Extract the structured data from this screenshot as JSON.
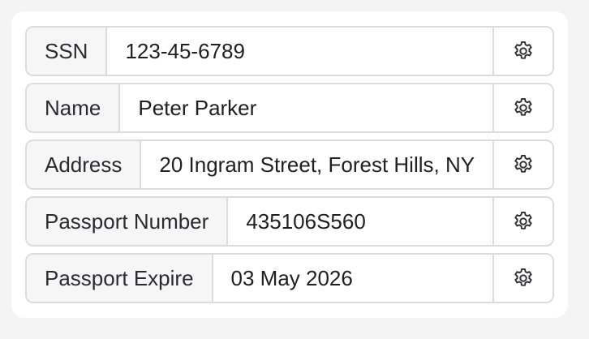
{
  "fields": [
    {
      "label": "SSN",
      "value": "123-45-6789",
      "icon": "gear-icon"
    },
    {
      "label": "Name",
      "value": "Peter Parker",
      "icon": "gear-icon"
    },
    {
      "label": "Address",
      "value": "20 Ingram Street, Forest Hills, NY",
      "icon": "gear-icon"
    },
    {
      "label": "Passport Number",
      "value": "435106S560",
      "icon": "gear-icon"
    },
    {
      "label": "Passport Expire",
      "value": "03 May 2026",
      "icon": "gear-icon"
    }
  ],
  "colors": {
    "border": "#dcdcdf",
    "label_bg": "#f6f6f7",
    "text": "#2b2b2e",
    "background": "#f4f4f5",
    "card": "#ffffff"
  }
}
